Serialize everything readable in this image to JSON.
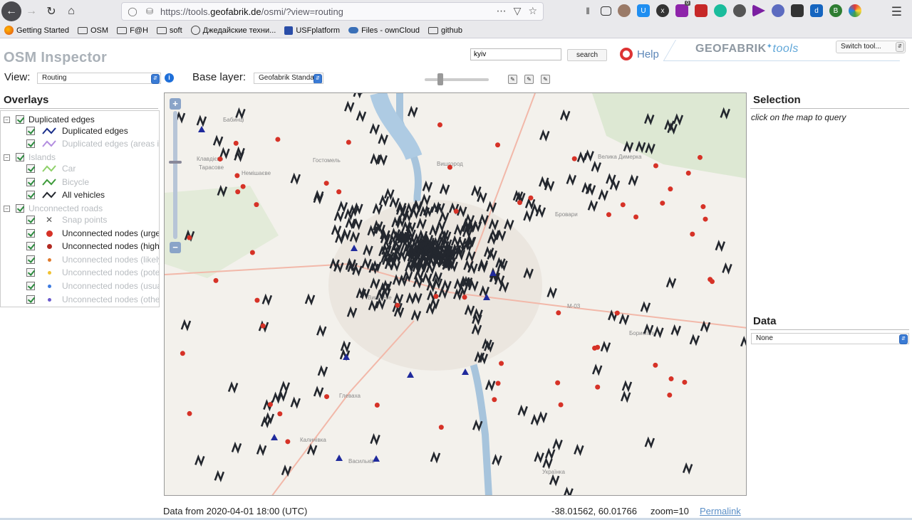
{
  "browser": {
    "url_prefix": "https://tools.",
    "url_domain": "geofabrik.de",
    "url_suffix": "/osmi/?view=routing",
    "bookmarks": [
      "Getting Started",
      "OSM",
      "F@H",
      "soft",
      "Джедайские техни...",
      "USFplatform",
      "Files - ownCloud",
      "github"
    ],
    "extension_badge": "0"
  },
  "app": {
    "title": "OSM Inspector",
    "search_value": "kyiv",
    "search_button": "search",
    "help_label": "Help",
    "logo_main": "GEOFABRIK",
    "logo_tools": "tools",
    "switch_tool": "Switch tool...",
    "view_label": "View:",
    "view_value": "Routing",
    "base_label": "Base layer:",
    "base_value": "Geofabrik Standard"
  },
  "overlays": {
    "title": "Overlays",
    "groups": [
      {
        "label": "Duplicated edges",
        "items": [
          "Duplicated edges",
          "Duplicated edges (areas in"
        ]
      },
      {
        "label": "Islands",
        "items": [
          "Car",
          "Bicycle",
          "All vehicles"
        ]
      },
      {
        "label": "Unconnected roads",
        "items": [
          "Snap points",
          "Unconnected nodes (urgen",
          "Unconnected nodes (high",
          "Unconnected nodes (likely",
          "Unconnected nodes (poten",
          "Unconnected nodes (usual",
          "Unconnected nodes (other"
        ]
      }
    ]
  },
  "map": {
    "place_labels": [
      "Бабинці",
      "Клавдієво",
      "Тарасове",
      "Немішаєве",
      "Гостомель",
      "Вишгород",
      "Велика Димерка",
      "Бровари",
      "Бориспіль",
      "Вишневе",
      "Глеваха",
      "Калинівка",
      "Васильків",
      "Українка",
      "М-03"
    ]
  },
  "selection": {
    "title": "Selection",
    "hint": "click on the map to query",
    "data_title": "Data",
    "data_value": "None"
  },
  "footer": {
    "data_from": "Data from 2020-04-01 18:00 (UTC)",
    "coords": "-38.01562, 60.01766",
    "zoom": "zoom=10",
    "permalink": "Permalink"
  },
  "colors": {
    "island_marker": "#23272e",
    "urgent_node": "#d63227",
    "high_node": "#b22a22",
    "snap_point": "#1f2a9c",
    "dup_edge": "#1a2f8a"
  }
}
